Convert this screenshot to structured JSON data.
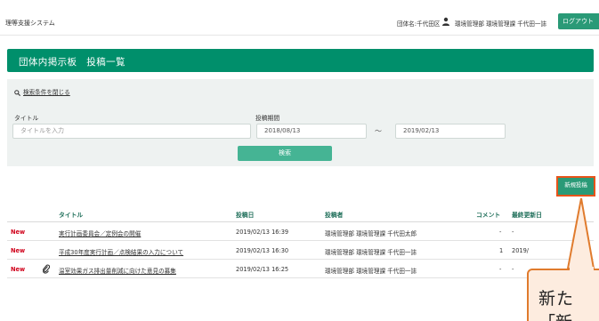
{
  "topbar": {
    "app_title": "理等支援システム",
    "org": "団体名:千代田区",
    "user_icon": "user-icon",
    "user_name": "環境管理部 環境管理課 千代田一誌",
    "logout_label": "ログアウト"
  },
  "header": {
    "title": "団体内掲示板　投稿一覧"
  },
  "search": {
    "toggle_label": "検索条件を閉じる",
    "title_label": "タイトル",
    "title_placeholder": "タイトルを入力",
    "period_label": "投稿期間",
    "date_from": "2018/08/13",
    "date_to": "2019/02/13",
    "tilde": "〜",
    "search_label": "検索"
  },
  "new_post_label": "新規投稿",
  "table": {
    "headers": {
      "title": "タイトル",
      "posted": "投稿日",
      "poster": "投稿者",
      "comments": "コメント",
      "updated": "最終更新日"
    },
    "rows": [
      {
        "badge": "New",
        "attachment": false,
        "title": "実行計画委員会／定例会の開催",
        "posted": "2019/02/13 16:39",
        "poster": "環境管理部 環境管理課 千代田太郎",
        "comments": "-",
        "updated": "-"
      },
      {
        "badge": "New",
        "attachment": false,
        "title": "平成30年度実行計画／点検結果の入力について",
        "posted": "2019/02/13 16:30",
        "poster": "環境管理部 環境管理課 千代田一誌",
        "comments": "1",
        "updated": "2019/"
      },
      {
        "badge": "New",
        "attachment": true,
        "title": "温室効果ガス排出量削減に向けた意見の募集",
        "posted": "2019/02/13 16:25",
        "poster": "環境管理部 環境管理課 千代田一誌",
        "comments": "-",
        "updated": "-"
      }
    ]
  },
  "callout": {
    "line1": "新た",
    "line2": "「新"
  }
}
